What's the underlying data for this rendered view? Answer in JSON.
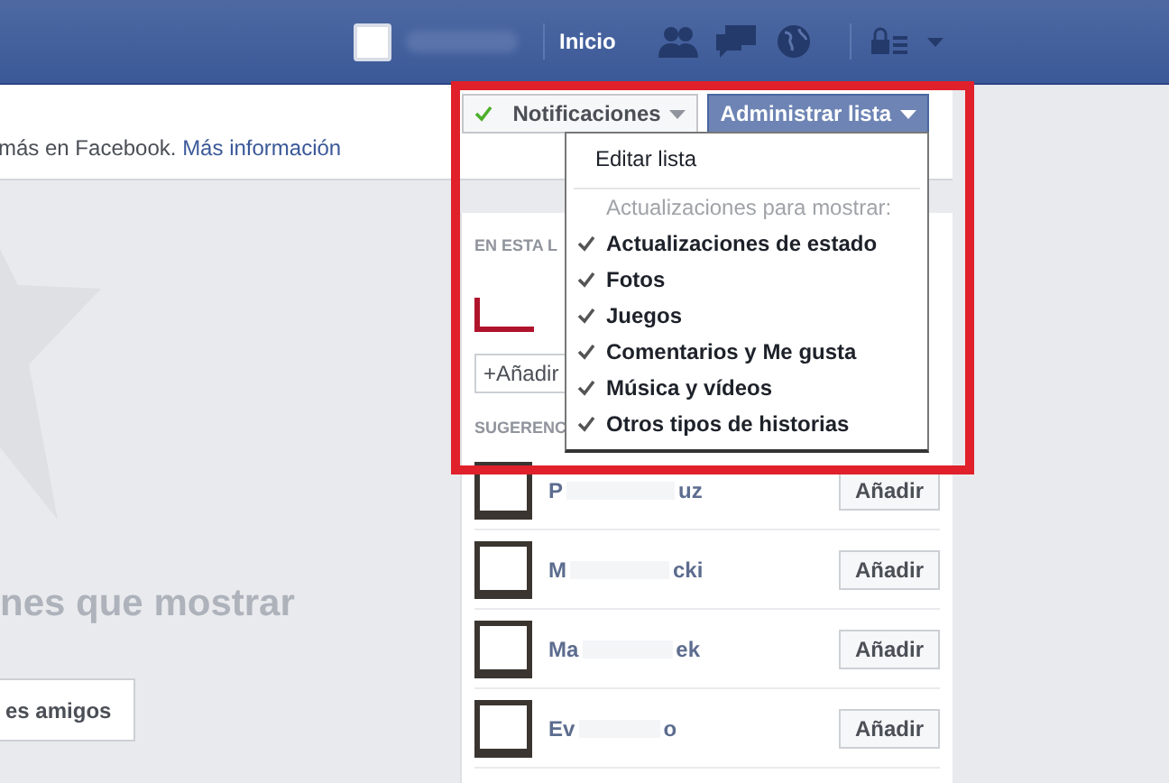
{
  "top_bar": {
    "home_link": "Inicio"
  },
  "header": {
    "info_text": "más en Facebook.",
    "info_link": "Más información"
  },
  "buttons": [
    {
      "kind": "toggle",
      "label": "Notificaciones",
      "checked": true
    },
    {
      "kind": "menu",
      "label": "Administrar lista",
      "expanded": true
    }
  ],
  "menu": {
    "items": [
      {
        "kind": "action",
        "label": "Editar lista"
      },
      {
        "kind": "heading",
        "label": "Actualizaciones para mostrar:"
      },
      {
        "kind": "option",
        "label": "Actualizaciones de estado",
        "checked": true
      },
      {
        "kind": "option",
        "label": "Fotos",
        "checked": true
      },
      {
        "kind": "option",
        "label": "Juegos",
        "checked": true
      },
      {
        "kind": "option",
        "label": "Comentarios y Me gusta",
        "checked": true
      },
      {
        "kind": "option",
        "label": "Música y vídeos",
        "checked": true
      },
      {
        "kind": "option",
        "label": "Otros tipos de historias",
        "checked": true
      }
    ]
  },
  "empty_state": {
    "message": "nes que mostrar",
    "button": "es amigos"
  },
  "sidebar": {
    "members_heading": "EN ESTA L",
    "add_button": "+Añadir",
    "suggestions_heading": "SUGERENC",
    "suggestions": [
      {
        "name_start": "P",
        "name_end": "uz",
        "button": "Añadir"
      },
      {
        "name_start": "M",
        "name_end": "cki",
        "button": "Añadir"
      },
      {
        "name_start": "Ma",
        "name_end": "ek",
        "button": "Añadir"
      },
      {
        "name_start": "Ev",
        "name_end": "o",
        "button": "Añadir"
      }
    ]
  }
}
